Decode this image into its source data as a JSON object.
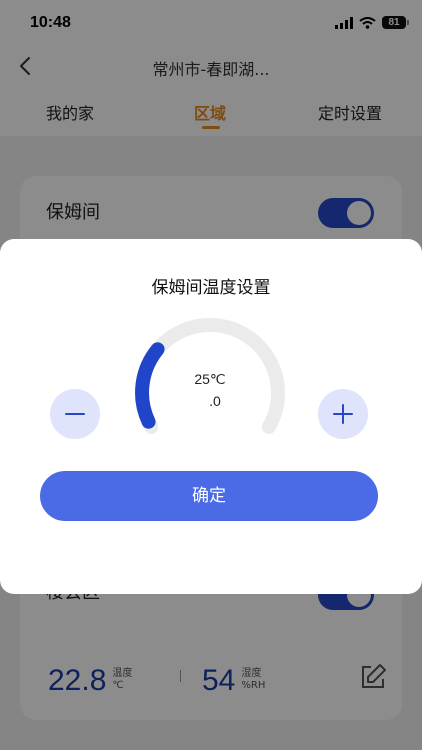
{
  "status_bar": {
    "time": "10:48",
    "battery": "81"
  },
  "nav": {
    "title": "常州市-春即湖..."
  },
  "tabs": [
    {
      "label": "我的家"
    },
    {
      "label": "区域",
      "active": true
    },
    {
      "label": "定时设置"
    }
  ],
  "rooms": [
    {
      "name": "保姆间",
      "enabled": true
    },
    {
      "name": "楼会区",
      "enabled": true,
      "temperature": {
        "value": "22.8",
        "label": "温度",
        "unit": "℃"
      },
      "humidity": {
        "value": "54",
        "label": "湿度",
        "unit": "%RH"
      }
    }
  ],
  "dialog": {
    "title": "保姆间温度设置",
    "setpoint": "25℃",
    "setpoint_decimal": ".0",
    "confirm_label": "确定"
  },
  "colors": {
    "accent_tab": "#e68a1c",
    "toggle_on": "#2747c8",
    "gauge_active": "#2145c8",
    "gauge_track": "#ebebeb",
    "confirm_button": "#4b6be6",
    "round_button_bg": "#dfe3fb",
    "reading_value": "#1d3ca8"
  },
  "icons": {
    "back": "chevron-left-icon",
    "minus": "minus-icon",
    "plus": "plus-icon",
    "edit": "edit-icon"
  }
}
